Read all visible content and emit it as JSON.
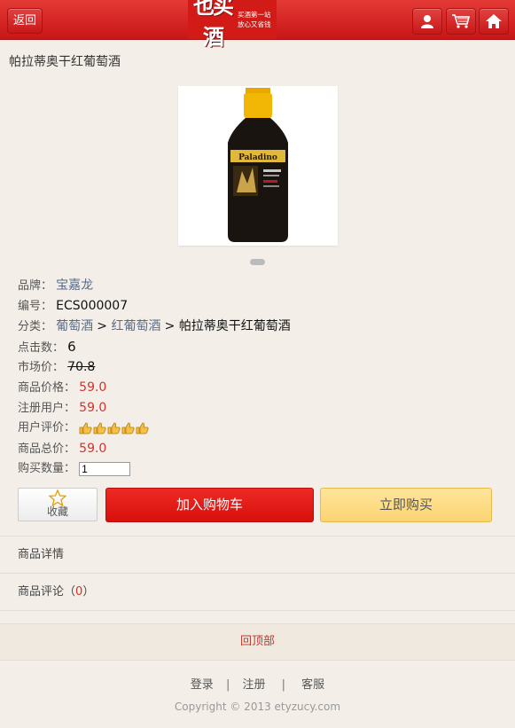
{
  "header": {
    "back_label": "返回",
    "logo_main": "也买酒",
    "logo_sub_1": "买酒第一站",
    "logo_sub_2": "放心又省钱",
    "icons": [
      "user-icon",
      "cart-icon",
      "home-icon"
    ],
    "accent_color": "#d21b17"
  },
  "product": {
    "title": "帕拉蒂奥干红葡萄酒",
    "bottle_label": "Paladino",
    "carousel_dots": 1
  },
  "info": {
    "brand_label": "品牌：",
    "brand_value": "宝嘉龙",
    "sn_label": "编号：",
    "sn_value": "ECS000007",
    "category_label": "分类：",
    "category_1": "葡萄酒",
    "category_sep_1": " > ",
    "category_2": "红葡萄酒",
    "category_sep_2": " > ",
    "category_3": "帕拉蒂奥干红葡萄酒",
    "clicks_label": "点击数：",
    "clicks_value": "6",
    "market_price_label": "市场价：",
    "market_price_value": "70.8",
    "shop_price_label": "商品价格：",
    "shop_price_value": "59.0",
    "member_price_label": "注册用户：",
    "member_price_value": "59.0",
    "rating_label": "用户评价：",
    "rating_value": 5,
    "rating_max": 5,
    "total_label": "商品总价：",
    "total_value": "59.0",
    "qty_label": "购买数量：",
    "qty_value": "1"
  },
  "actions": {
    "favorite_label": "收藏",
    "add_cart_label": "加入购物车",
    "buy_now_label": "立即购买"
  },
  "sections": {
    "details_label": "商品详情",
    "comments_label": "商品评论",
    "comments_open": "（",
    "comments_count": "0",
    "comments_close": "）"
  },
  "footer": {
    "back_top_label": "回顶部",
    "login_label": "登录",
    "sep": "|",
    "register_label": "注册",
    "service_label": "客服",
    "copyright": "Copyright © 2013 etyzucy.com"
  }
}
